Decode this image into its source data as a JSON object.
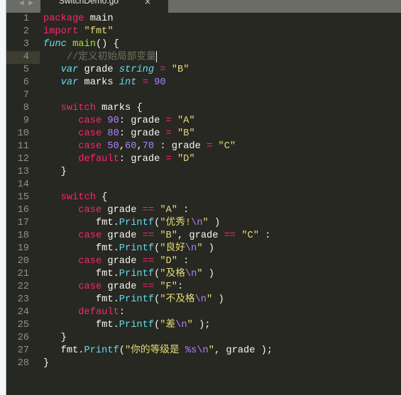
{
  "tab": {
    "title": "SwitchDemo.go",
    "close": "×",
    "nav": "◀ ▶"
  },
  "theme": {
    "background": "#272822",
    "keyword": "#f92672",
    "string": "#e6db74",
    "type": "#66d9ef",
    "function": "#a6e22e",
    "number": "#ae81ff",
    "comment": "#75715e"
  },
  "active_line": 4,
  "lines": [
    {
      "n": "1",
      "tokens": [
        [
          "kw",
          "package"
        ],
        [
          "pl",
          " main"
        ]
      ]
    },
    {
      "n": "2",
      "tokens": [
        [
          "kw",
          "import"
        ],
        [
          "pl",
          " "
        ],
        [
          "str",
          "\"fmt\""
        ]
      ]
    },
    {
      "n": "3",
      "tokens": [
        [
          "st",
          "func"
        ],
        [
          "pl",
          " "
        ],
        [
          "fn",
          "main"
        ],
        [
          "pl",
          "() {"
        ]
      ]
    },
    {
      "n": "4",
      "tokens": [
        [
          "pl",
          "    "
        ],
        [
          "cm",
          "//定义初始局部变量"
        ]
      ]
    },
    {
      "n": "5",
      "tokens": [
        [
          "pl",
          "   "
        ],
        [
          "st",
          "var"
        ],
        [
          "pl",
          " grade "
        ],
        [
          "st",
          "string"
        ],
        [
          "pl",
          " "
        ],
        [
          "kw",
          "="
        ],
        [
          "pl",
          " "
        ],
        [
          "str",
          "\"B\""
        ]
      ]
    },
    {
      "n": "6",
      "tokens": [
        [
          "pl",
          "   "
        ],
        [
          "st",
          "var"
        ],
        [
          "pl",
          " marks "
        ],
        [
          "st",
          "int"
        ],
        [
          "pl",
          " "
        ],
        [
          "kw",
          "="
        ],
        [
          "pl",
          " "
        ],
        [
          "num",
          "90"
        ]
      ]
    },
    {
      "n": "7",
      "tokens": []
    },
    {
      "n": "8",
      "tokens": [
        [
          "pl",
          "   "
        ],
        [
          "kw",
          "switch"
        ],
        [
          "pl",
          " marks {"
        ]
      ]
    },
    {
      "n": "9",
      "tokens": [
        [
          "pl",
          "      "
        ],
        [
          "kw",
          "case"
        ],
        [
          "pl",
          " "
        ],
        [
          "num",
          "90"
        ],
        [
          "pl",
          ": grade "
        ],
        [
          "kw",
          "="
        ],
        [
          "pl",
          " "
        ],
        [
          "str",
          "\"A\""
        ]
      ]
    },
    {
      "n": "10",
      "tokens": [
        [
          "pl",
          "      "
        ],
        [
          "kw",
          "case"
        ],
        [
          "pl",
          " "
        ],
        [
          "num",
          "80"
        ],
        [
          "pl",
          ": grade "
        ],
        [
          "kw",
          "="
        ],
        [
          "pl",
          " "
        ],
        [
          "str",
          "\"B\""
        ]
      ]
    },
    {
      "n": "11",
      "tokens": [
        [
          "pl",
          "      "
        ],
        [
          "kw",
          "case"
        ],
        [
          "pl",
          " "
        ],
        [
          "num",
          "50"
        ],
        [
          "pl",
          ","
        ],
        [
          "num",
          "60"
        ],
        [
          "pl",
          ","
        ],
        [
          "num",
          "70"
        ],
        [
          "pl",
          " : grade "
        ],
        [
          "kw",
          "="
        ],
        [
          "pl",
          " "
        ],
        [
          "str",
          "\"C\""
        ]
      ]
    },
    {
      "n": "12",
      "tokens": [
        [
          "pl",
          "      "
        ],
        [
          "kw",
          "default"
        ],
        [
          "pl",
          ": grade "
        ],
        [
          "kw",
          "="
        ],
        [
          "pl",
          " "
        ],
        [
          "str",
          "\"D\""
        ]
      ]
    },
    {
      "n": "13",
      "tokens": [
        [
          "pl",
          "   }"
        ]
      ]
    },
    {
      "n": "14",
      "tokens": []
    },
    {
      "n": "15",
      "tokens": [
        [
          "pl",
          "   "
        ],
        [
          "kw",
          "switch"
        ],
        [
          "pl",
          " {"
        ]
      ]
    },
    {
      "n": "16",
      "tokens": [
        [
          "pl",
          "      "
        ],
        [
          "kw",
          "case"
        ],
        [
          "pl",
          " grade "
        ],
        [
          "kw",
          "=="
        ],
        [
          "pl",
          " "
        ],
        [
          "str",
          "\"A\""
        ],
        [
          "pl",
          " :"
        ]
      ]
    },
    {
      "n": "17",
      "tokens": [
        [
          "pl",
          "         fmt."
        ],
        [
          "call",
          "Printf"
        ],
        [
          "pl",
          "("
        ],
        [
          "str",
          "\"优秀!"
        ],
        [
          "esc",
          "\\n"
        ],
        [
          "str",
          "\""
        ],
        [
          "pl",
          " )"
        ]
      ]
    },
    {
      "n": "18",
      "tokens": [
        [
          "pl",
          "      "
        ],
        [
          "kw",
          "case"
        ],
        [
          "pl",
          " grade "
        ],
        [
          "kw",
          "=="
        ],
        [
          "pl",
          " "
        ],
        [
          "str",
          "\"B\""
        ],
        [
          "pl",
          ", grade "
        ],
        [
          "kw",
          "=="
        ],
        [
          "pl",
          " "
        ],
        [
          "str",
          "\"C\""
        ],
        [
          "pl",
          " :"
        ]
      ]
    },
    {
      "n": "19",
      "tokens": [
        [
          "pl",
          "         fmt."
        ],
        [
          "call",
          "Printf"
        ],
        [
          "pl",
          "("
        ],
        [
          "str",
          "\"良好"
        ],
        [
          "esc",
          "\\n"
        ],
        [
          "str",
          "\""
        ],
        [
          "pl",
          " )"
        ]
      ]
    },
    {
      "n": "20",
      "tokens": [
        [
          "pl",
          "      "
        ],
        [
          "kw",
          "case"
        ],
        [
          "pl",
          " grade "
        ],
        [
          "kw",
          "=="
        ],
        [
          "pl",
          " "
        ],
        [
          "str",
          "\"D\""
        ],
        [
          "pl",
          " :"
        ]
      ]
    },
    {
      "n": "21",
      "tokens": [
        [
          "pl",
          "         fmt."
        ],
        [
          "call",
          "Printf"
        ],
        [
          "pl",
          "("
        ],
        [
          "str",
          "\"及格"
        ],
        [
          "esc",
          "\\n"
        ],
        [
          "str",
          "\""
        ],
        [
          "pl",
          " )"
        ]
      ]
    },
    {
      "n": "22",
      "tokens": [
        [
          "pl",
          "      "
        ],
        [
          "kw",
          "case"
        ],
        [
          "pl",
          " grade "
        ],
        [
          "kw",
          "=="
        ],
        [
          "pl",
          " "
        ],
        [
          "str",
          "\"F\""
        ],
        [
          "pl",
          ":"
        ]
      ]
    },
    {
      "n": "23",
      "tokens": [
        [
          "pl",
          "         fmt."
        ],
        [
          "call",
          "Printf"
        ],
        [
          "pl",
          "("
        ],
        [
          "str",
          "\"不及格"
        ],
        [
          "esc",
          "\\n"
        ],
        [
          "str",
          "\""
        ],
        [
          "pl",
          " )"
        ]
      ]
    },
    {
      "n": "24",
      "tokens": [
        [
          "pl",
          "      "
        ],
        [
          "kw",
          "default"
        ],
        [
          "pl",
          ":"
        ]
      ]
    },
    {
      "n": "25",
      "tokens": [
        [
          "pl",
          "         fmt."
        ],
        [
          "call",
          "Printf"
        ],
        [
          "pl",
          "("
        ],
        [
          "str",
          "\"差"
        ],
        [
          "esc",
          "\\n"
        ],
        [
          "str",
          "\""
        ],
        [
          "pl",
          " );"
        ]
      ]
    },
    {
      "n": "26",
      "tokens": [
        [
          "pl",
          "   }"
        ]
      ]
    },
    {
      "n": "27",
      "tokens": [
        [
          "pl",
          "   fmt."
        ],
        [
          "call",
          "Printf"
        ],
        [
          "pl",
          "("
        ],
        [
          "str",
          "\"你的等级是 "
        ],
        [
          "esc",
          "%s\\n"
        ],
        [
          "str",
          "\""
        ],
        [
          "pl",
          ", grade );"
        ]
      ]
    },
    {
      "n": "28",
      "tokens": [
        [
          "pl",
          "}"
        ]
      ]
    }
  ]
}
